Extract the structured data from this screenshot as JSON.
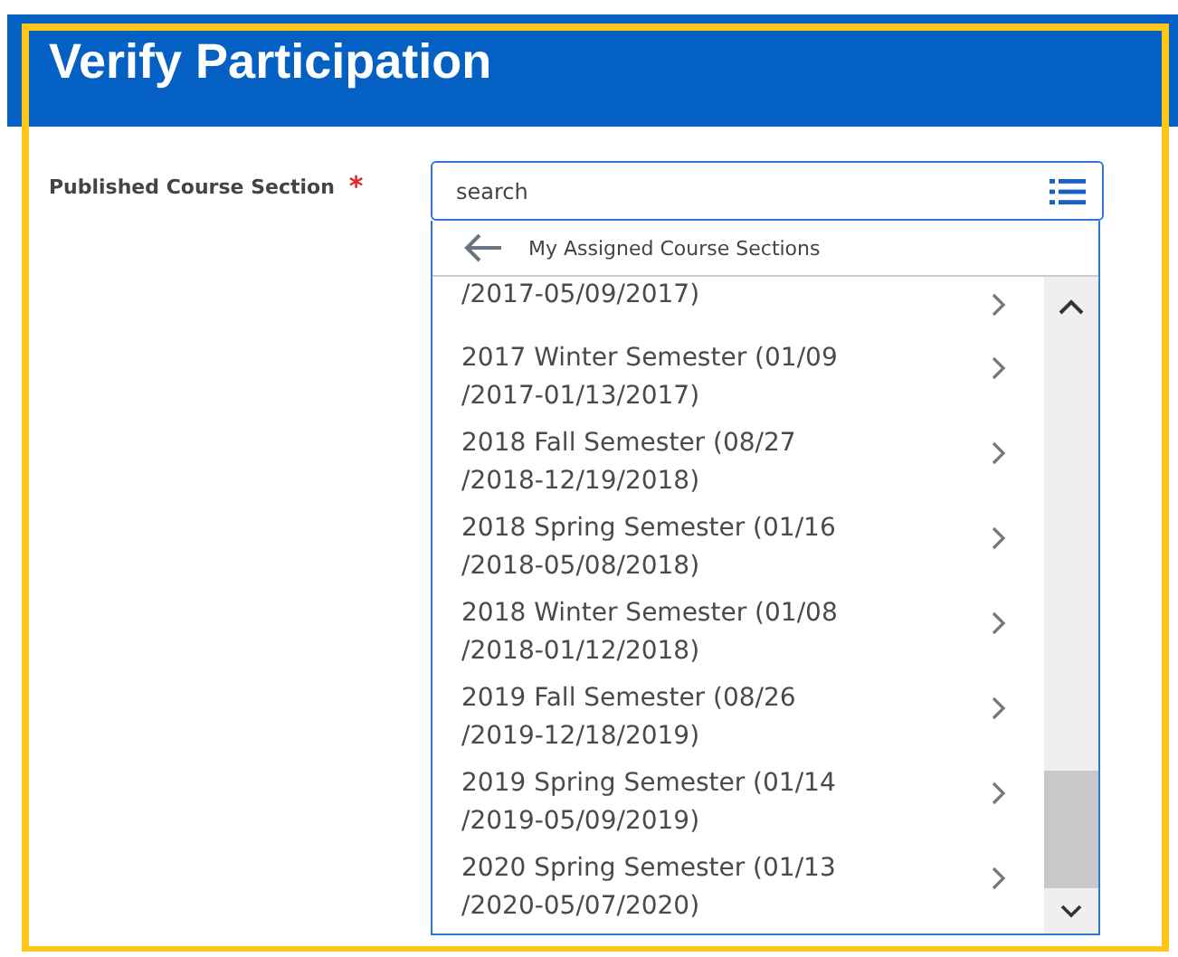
{
  "page": {
    "title": "Verify Participation"
  },
  "field": {
    "label": "Published Course Section",
    "required_mark": "*",
    "placeholder": "search"
  },
  "dropdown": {
    "header": "My Assigned Course Sections",
    "items": [
      {
        "lines": [
          "/2017-05/09/2017)"
        ]
      },
      {
        "lines": [
          "2017 Winter Semester (01/09",
          "/2017-01/13/2017)"
        ]
      },
      {
        "lines": [
          "2018 Fall Semester (08/27",
          "/2018-12/19/2018)"
        ]
      },
      {
        "lines": [
          "2018 Spring Semester (01/16",
          "/2018-05/08/2018)"
        ]
      },
      {
        "lines": [
          "2018 Winter Semester (01/08",
          "/2018-01/12/2018)"
        ]
      },
      {
        "lines": [
          "2019 Fall Semester (08/26",
          "/2019-12/18/2019)"
        ]
      },
      {
        "lines": [
          "2019 Spring Semester (01/14",
          "/2019-05/09/2019)"
        ]
      },
      {
        "lines": [
          "2020 Spring Semester (01/13",
          "/2020-05/07/2020)"
        ]
      }
    ]
  }
}
